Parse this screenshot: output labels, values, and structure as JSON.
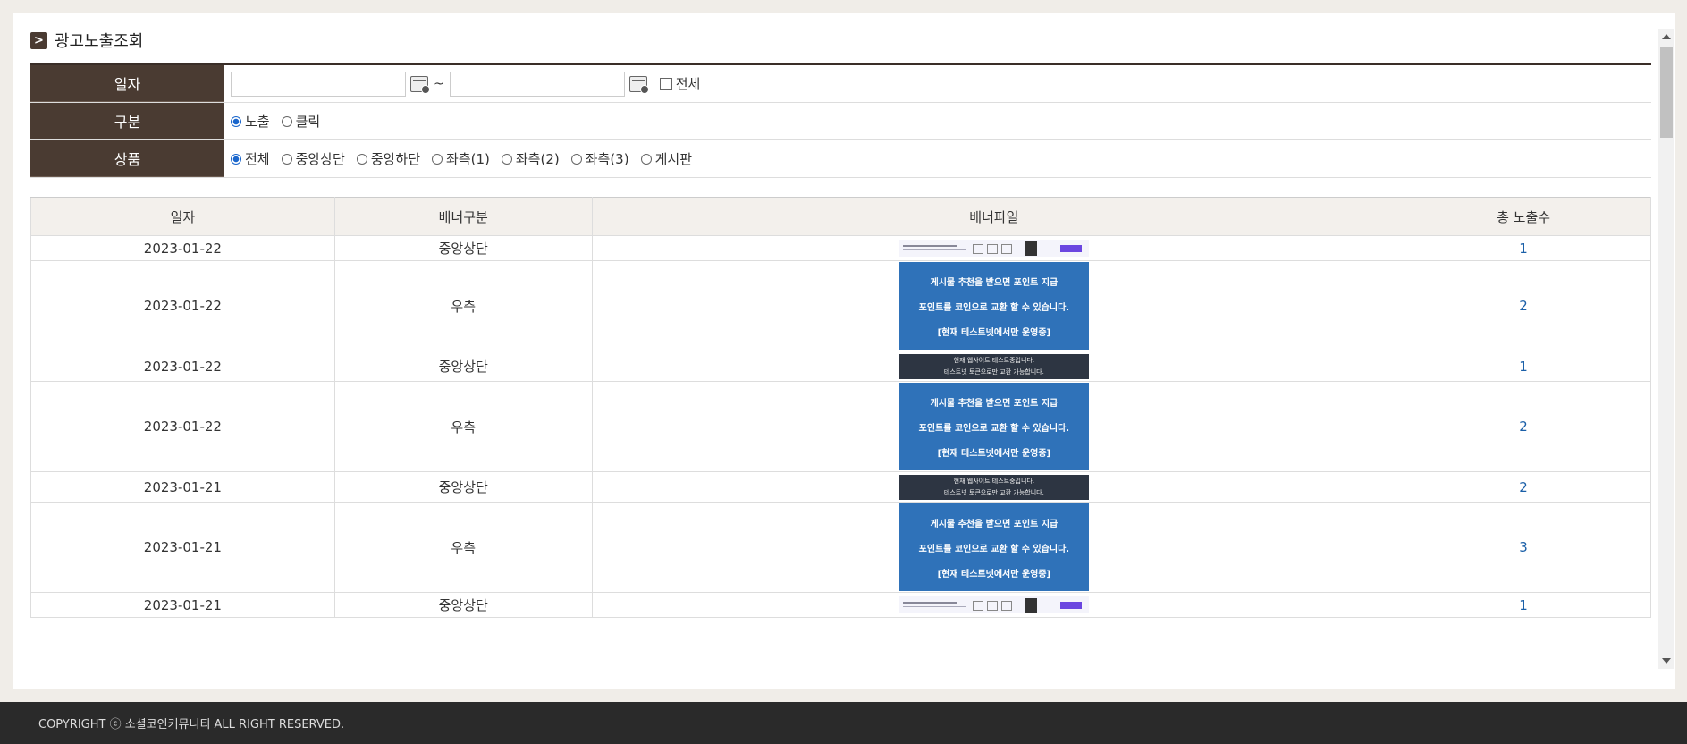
{
  "page": {
    "title": "광고노출조회",
    "title_icon": "chevron-right-icon"
  },
  "search": {
    "date_label": "일자",
    "date_from": "",
    "date_to": "",
    "tilde": "~",
    "all_checkbox_label": "전체",
    "all_checked": false,
    "type_label": "구분",
    "type_options": [
      "노출",
      "클릭"
    ],
    "type_selected": "노출",
    "product_label": "상품",
    "product_options": [
      "전체",
      "중앙상단",
      "중앙하단",
      "좌측(1)",
      "좌측(2)",
      "좌측(3)",
      "게시판"
    ],
    "product_selected": "전체"
  },
  "table": {
    "headers": [
      "일자",
      "배너구분",
      "배너파일",
      "총 노출수"
    ],
    "rows": [
      {
        "date": "2023-01-22",
        "type": "중앙상단",
        "banner": "A",
        "count": "1"
      },
      {
        "date": "2023-01-22",
        "type": "우측",
        "banner": "B",
        "count": "2"
      },
      {
        "date": "2023-01-22",
        "type": "중앙상단",
        "banner": "C",
        "count": "1"
      },
      {
        "date": "2023-01-22",
        "type": "우측",
        "banner": "B",
        "count": "2"
      },
      {
        "date": "2023-01-21",
        "type": "중앙상단",
        "banner": "C",
        "count": "2"
      },
      {
        "date": "2023-01-21",
        "type": "우측",
        "banner": "B",
        "count": "3"
      },
      {
        "date": "2023-01-21",
        "type": "중앙상단",
        "banner": "A",
        "count": "1"
      }
    ]
  },
  "banner_b_text": [
    "게시물 추천을 받으면 포인트 지급",
    "포인트를 코인으로 교환 할 수 있습니다.",
    "[현재 테스트넷에서만 운영중]"
  ],
  "banner_c_text": [
    "현재 웹사이트 테스트중입니다.",
    "테스트넷 토큰으로만 교환 가능합니다."
  ],
  "footer": {
    "copyright": "COPYRIGHT ⓒ 소셜코인커뮤니티 ALL RIGHT RESERVED."
  },
  "colors": {
    "label_bg": "#4a3b32",
    "link": "#1a5fa8",
    "banner_blue": "#2f72b9",
    "footer_bg": "#2a2a2a"
  }
}
